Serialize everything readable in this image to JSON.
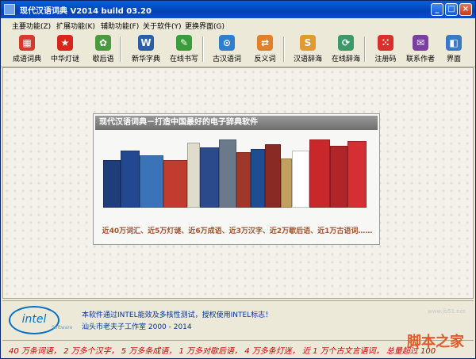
{
  "window": {
    "title": "现代汉语词典 V2014 build 03.20"
  },
  "menu": [
    "主要功能(Z)",
    "扩展功能(K)",
    "辅助功能(F)",
    "关于软件(Y)",
    "更换界面(G)"
  ],
  "toolbar": [
    {
      "label": "成语词典",
      "icon": "grid-icon",
      "color": "#d53a2e"
    },
    {
      "label": "中华灯谜",
      "icon": "star-icon",
      "color": "#d9261c"
    },
    {
      "label": "歇后语",
      "icon": "gear-icon",
      "color": "#4a9a3f"
    },
    {
      "label": "新华字典",
      "icon": "book-icon",
      "color": "#2a5fa8"
    },
    {
      "label": "在线书写",
      "icon": "pen-icon",
      "color": "#3a9c3a"
    },
    {
      "label": "古汉语词",
      "icon": "compass-icon",
      "color": "#2f7fd0"
    },
    {
      "label": "反义词",
      "icon": "swap-icon",
      "color": "#e0802a"
    },
    {
      "label": "汉语辞海",
      "icon": "seal-icon",
      "color": "#e09a30"
    },
    {
      "label": "在线辞海",
      "icon": "clock-icon",
      "color": "#3a9a6a"
    },
    {
      "label": "注册码",
      "icon": "dice-icon",
      "color": "#d8302a"
    },
    {
      "label": "联系作者",
      "icon": "mail-icon",
      "color": "#7a3fa0"
    },
    {
      "label": "界面",
      "icon": "theme-icon",
      "color": "#3a78c8"
    }
  ],
  "panel": {
    "title": "现代汉语词典－打造中国最好的电子辞典软件",
    "caption": "近40万词汇、近5万灯谜、近6万成语、近3万汉字、近2万歇后语、近1万古语词……"
  },
  "footer": {
    "logo": "intel",
    "logo_sub": "Software",
    "line1": "本软件通过INTEL能效及多核性测试，授权使用INTEL标志！",
    "line2": "汕头市老夫子工作室 2000 - 2014"
  },
  "status": "40 万条词语， 2 万多个汉字， 5 万多条成语， 1 万多对歇后语， 4 万多条灯迷， 近 1 万个古文言语词， 总量超过 100",
  "watermark": {
    "main": "脚本之家",
    "sub": "www.jb51.net"
  }
}
